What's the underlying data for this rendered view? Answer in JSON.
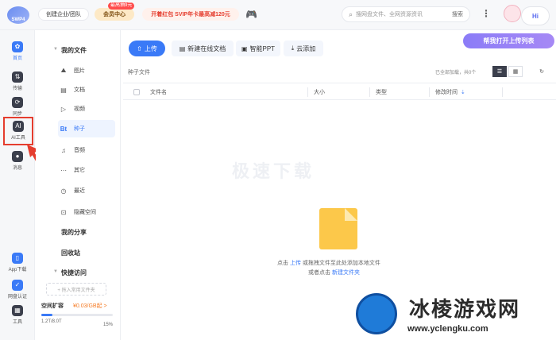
{
  "header": {
    "logo_text": "SWP4",
    "enterprise_label": "创建企业/团队",
    "vip_label": "会员中心",
    "vip_badge": "最高抽9元",
    "promo_label": "开着红包 SVIP年卡最高减120元",
    "search_placeholder": "搜网盘文件、全网资源资讯",
    "search_button": "搜索",
    "hi_label": "Hi"
  },
  "left_nav": [
    {
      "label": "首页",
      "icon": "home-icon"
    },
    {
      "label": "传输",
      "icon": "transfer-icon"
    },
    {
      "label": "同步",
      "icon": "sync-icon"
    },
    {
      "label": "AI工具",
      "icon": "ai-tool-icon"
    },
    {
      "label": "消息",
      "icon": "message-icon"
    },
    {
      "label": "App下载",
      "icon": "app-download-icon"
    },
    {
      "label": "网盘认证",
      "icon": "verify-icon"
    },
    {
      "label": "工具",
      "icon": "tools-icon"
    }
  ],
  "file_panel": {
    "my_files": "我的文件",
    "items": [
      {
        "label": "图片",
        "icon": "image-icon"
      },
      {
        "label": "文档",
        "icon": "document-icon"
      },
      {
        "label": "视频",
        "icon": "video-icon"
      },
      {
        "label": "种子",
        "icon": "torrent-icon"
      },
      {
        "label": "音频",
        "icon": "audio-icon"
      },
      {
        "label": "其它",
        "icon": "other-icon"
      },
      {
        "label": "最近",
        "icon": "recent-icon"
      },
      {
        "label": "隐藏空间",
        "icon": "lock-icon"
      }
    ],
    "my_share": "我的分享",
    "recycle": "回收站",
    "quick_access": "快捷访问",
    "add_fav": "+ 拖入常用文件夹",
    "quota_title": "空间扩容",
    "quota_price": "¥0.03/GB起 >",
    "quota_used": "1.2T/8.0T",
    "quota_pct": "15%",
    "quota_fraction": 0.15
  },
  "toolbar": {
    "upload": "上传",
    "new_doc": "新建在线文档",
    "smart_ppt": "智能PPT",
    "cloud_add": "云添加"
  },
  "tip": "帮我打开上传列表",
  "breadcrumb": "种子文件",
  "loaded_text": "已全部加载，共0个",
  "table": {
    "columns": [
      "文件名",
      "大小",
      "类型",
      "修改时间"
    ]
  },
  "watermark_text": "极速下载",
  "empty": {
    "line1_pre": "点击",
    "line1_link": "上传",
    "line1_post": "或拖拽文件至此处添加本地文件",
    "line2_pre": "或者点击",
    "line2_link": "新建文件夹"
  },
  "site_watermark": {
    "name": "冰棱游戏网",
    "url": "www.yclengku.com"
  },
  "colors": {
    "accent": "#3a7af7",
    "highlight": "#e53d2e"
  }
}
